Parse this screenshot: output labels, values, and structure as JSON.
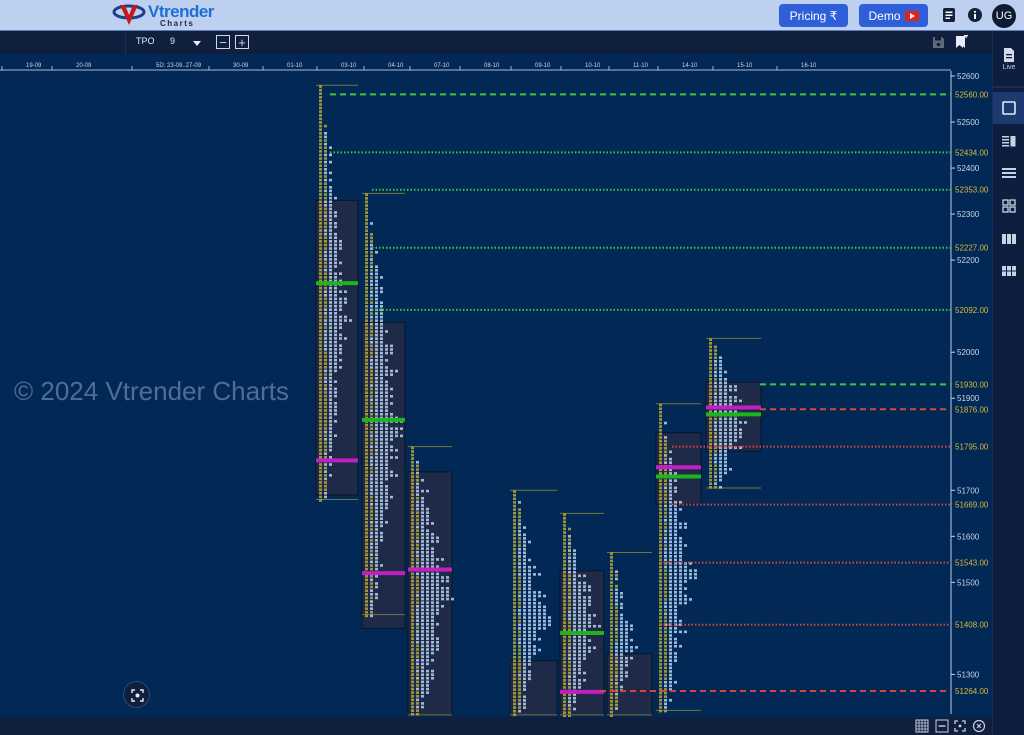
{
  "app": {
    "logo_brand": "Vtrender",
    "logo_sub": "Charts",
    "pricing_label": "Pricing ₹",
    "demo_label": "Demo",
    "avatar_initials": "UG"
  },
  "toolbar": {
    "chart_type": "TPO",
    "period_value": "9",
    "minus_label": "−",
    "plus_label": "+"
  },
  "sidebar": {
    "live_label": "Live"
  },
  "watermark": "© 2024 Vtrender Charts",
  "colors": {
    "chart_bg": "#022955",
    "value_area_bg": "#1e2a48",
    "poc_green": "#1fb31f",
    "poc_magenta": "#c21ec2",
    "level_green": "#3fc73f",
    "level_red": "#d6453c",
    "level_label": "#d9b83a",
    "tick_label": "#c8d4e6",
    "tpo_yellow": "#b8a838",
    "tpo_blue": "#b9d2ee"
  },
  "chart_data": {
    "type": "tpo",
    "title": "",
    "x_axis_dates": [
      "19-09",
      "20-09",
      "5D: 23-09..27-09",
      "30-09",
      "01-10",
      "03-10",
      "04-10",
      "07-10",
      "08-10",
      "09-10",
      "10-10",
      "11-10",
      "14-10",
      "15-10",
      "16-10"
    ],
    "y_axis_ticks": [
      52600,
      52500,
      52400,
      52300,
      52200,
      52000,
      51900,
      51700,
      51600,
      51500,
      51300
    ],
    "ylim": [
      51212,
      52615
    ],
    "reference_levels": [
      {
        "value": 52560.0,
        "label": "52560.00",
        "color": "green",
        "style": "dashed"
      },
      {
        "value": 52434.0,
        "label": "52434.00",
        "color": "green",
        "style": "dotted"
      },
      {
        "value": 52353.0,
        "label": "52353.00",
        "color": "green",
        "style": "dotted"
      },
      {
        "value": 52227.0,
        "label": "52227.00",
        "color": "green",
        "style": "dotted"
      },
      {
        "value": 52092.0,
        "label": "52092.00",
        "color": "green",
        "style": "dotted"
      },
      {
        "value": 51930.0,
        "label": "51930.00",
        "color": "green",
        "style": "dashed"
      },
      {
        "value": 51876.0,
        "label": "51876.00",
        "color": "red",
        "style": "dashed"
      },
      {
        "value": 51795.0,
        "label": "51795.00",
        "color": "red",
        "style": "dotted"
      },
      {
        "value": 51669.0,
        "label": "51669.00",
        "color": "red",
        "style": "dotted"
      },
      {
        "value": 51543.0,
        "label": "51543.00",
        "color": "red",
        "style": "dotted"
      },
      {
        "value": 51408.0,
        "label": "51408.00",
        "color": "red",
        "style": "dotted"
      },
      {
        "value": 51264.0,
        "label": "51264.00",
        "color": "red",
        "style": "dashed"
      }
    ],
    "profiles": [
      {
        "date": "03-10",
        "high": 52580,
        "low": 51680,
        "vah": 52330,
        "val": 51690,
        "poc": 52150,
        "poc_color": "green",
        "vpoc": 51765,
        "vpoc_color": "magenta",
        "width": 6
      },
      {
        "date": "04-10",
        "high": 52345,
        "low": 51430,
        "vah": 52065,
        "val": 51400,
        "poc": 51853,
        "poc_color": "green",
        "vpoc": 51520,
        "vpoc_color": "magenta",
        "width": 7
      },
      {
        "date": "07-10",
        "high": 51795,
        "low": 51212,
        "vah": 51740,
        "val": 51212,
        "poc": 51528,
        "poc_color": "magenta",
        "width": 8
      },
      {
        "date": "09-10",
        "high": 51700,
        "low": 51212,
        "vah": 51330,
        "val": 51212,
        "poc": 51610,
        "poc_color": "none",
        "width": 7
      },
      {
        "date": "10-10",
        "high": 51650,
        "low": 51212,
        "vah": 51525,
        "val": 51212,
        "poc": 51390,
        "poc_color": "green",
        "vpoc": 51262,
        "vpoc_color": "magenta",
        "width": 7
      },
      {
        "date": "11-10",
        "high": 51565,
        "low": 51212,
        "vah": 51345,
        "val": 51212,
        "poc": 51290,
        "poc_color": "none",
        "width": 5
      },
      {
        "date": "14-10",
        "high": 51888,
        "low": 51222,
        "vah": 51825,
        "val": 51670,
        "poc": 51730,
        "poc_color": "green",
        "vpoc": 51750,
        "vpoc_color": "magenta",
        "width": 7
      },
      {
        "date": "15-10",
        "high": 52030,
        "low": 51705,
        "vah": 51935,
        "val": 51785,
        "poc": 51865,
        "poc_color": "green",
        "vpoc": 51880,
        "vpoc_color": "magenta",
        "width": 8
      }
    ]
  }
}
